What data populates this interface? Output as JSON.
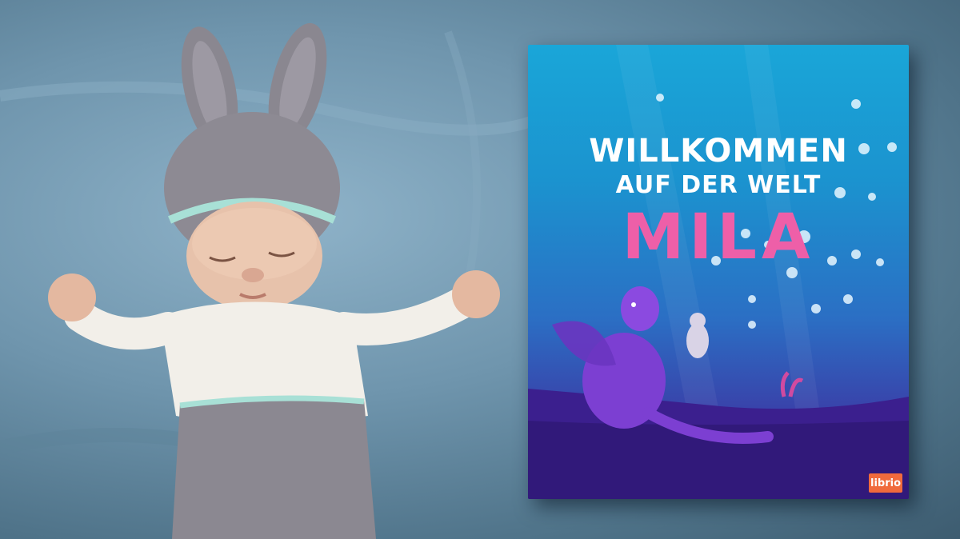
{
  "book": {
    "title_line1": "WILLKOMMEN",
    "title_line2": "AUF DER WELT",
    "name": "MILA",
    "publisher": "librio"
  },
  "colors": {
    "background": "#6f95ad",
    "cover_top": "#1aa6d8",
    "cover_bottom": "#44269a",
    "name_pink": "#ee5fa8",
    "logo_orange": "#f06a3c"
  }
}
